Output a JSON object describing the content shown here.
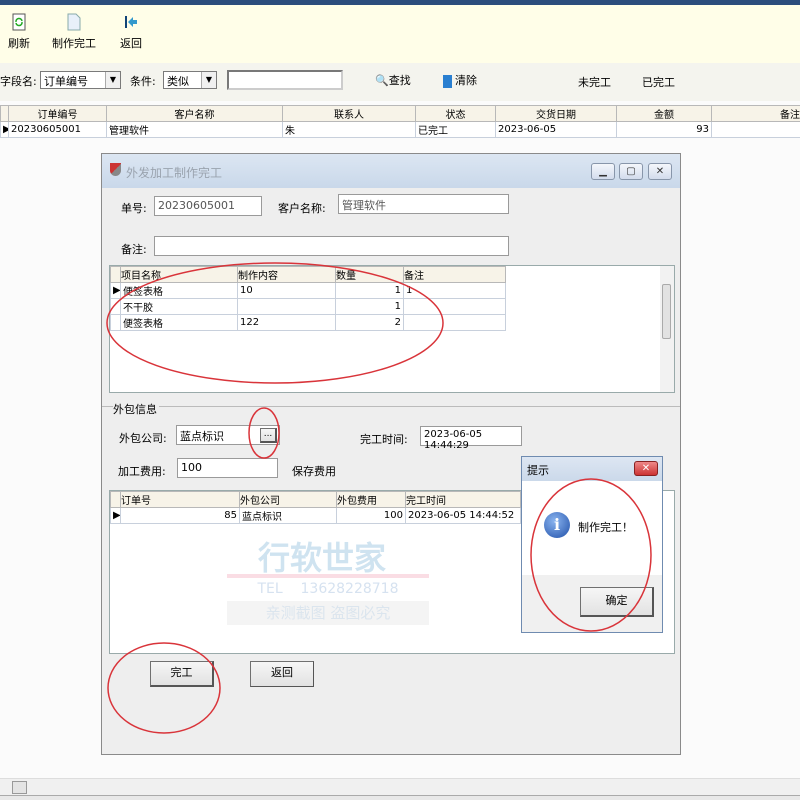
{
  "toolbar": {
    "items": [
      {
        "label": "刷新",
        "icon": "refresh-icon"
      },
      {
        "label": "制作完工",
        "icon": "document-icon"
      },
      {
        "label": "返回",
        "icon": "back-arrow-icon"
      }
    ]
  },
  "filter": {
    "field_label": "字段名:",
    "field_value": "订单编号",
    "cond_label": "条件:",
    "cond_value": "类似",
    "search_value": "",
    "find_label": "查找",
    "clear_label": "清除",
    "unfinished_label": "未完工",
    "finished_label": "已完工"
  },
  "main_grid": {
    "columns": [
      "订单编号",
      "客户名称",
      "联系人",
      "状态",
      "交货日期",
      "金额",
      "备注"
    ],
    "rows": [
      [
        "20230605001",
        "管理软件",
        "朱",
        "已完工",
        "2023-06-05",
        "93",
        ""
      ]
    ]
  },
  "dialog": {
    "title": "外发加工制作完工",
    "order_label": "单号:",
    "order_value": "20230605001",
    "customer_label": "客户名称:",
    "customer_value": "管理软件",
    "note_label": "备注:",
    "note_value": "",
    "items_grid": {
      "columns": [
        "项目名称",
        "制作内容",
        "数量",
        "备注"
      ],
      "rows": [
        [
          "便签表格",
          "10",
          "1",
          "1"
        ],
        [
          "不干胶",
          "",
          "1",
          ""
        ],
        [
          "便签表格",
          "122",
          "2",
          ""
        ]
      ]
    },
    "outsource_group": "外包信息",
    "company_label": "外包公司:",
    "company_value": "蓝点标识",
    "browse_label": "...",
    "finish_time_label": "完工时间:",
    "finish_time_value": "2023-06-05 14:44:29",
    "fee_label": "加工费用:",
    "fee_value": "100",
    "save_fee_label": "保存费用",
    "out_grid": {
      "columns": [
        "订单号",
        "外包公司",
        "外包费用",
        "完工时间"
      ],
      "rows": [
        [
          "85",
          "蓝点标识",
          "100",
          "2023-06-05 14:44:52"
        ]
      ]
    },
    "finish_button": "完工",
    "back_button": "返回"
  },
  "watermark": {
    "brand": "行软世家",
    "tel": "TEL    13628228718",
    "notice": "亲测截图  盗图必究"
  },
  "message_box": {
    "title": "提示",
    "text": "制作完工！",
    "ok_button": "确定",
    "icon": "info-icon"
  },
  "colors": {
    "title_bar": "#2c4d7c",
    "toolbar_bg": "#fffee8",
    "annotation": "#d9343a"
  }
}
